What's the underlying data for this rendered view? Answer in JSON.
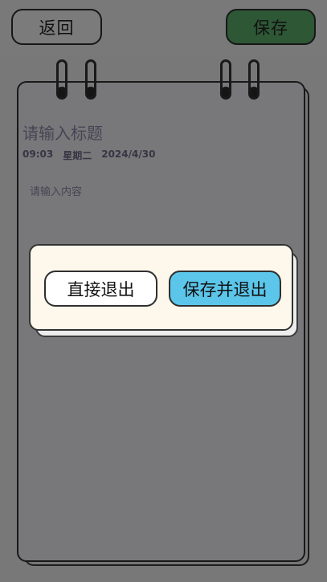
{
  "header": {
    "back_label": "返回",
    "save_label": "保存"
  },
  "note": {
    "title_placeholder": "请输入标题",
    "time": "09:03",
    "weekday": "星期二",
    "date": "2024/4/30",
    "content_placeholder": "请输入内容"
  },
  "dialog": {
    "exit_label": "直接退出",
    "save_exit_label": "保存并退出"
  },
  "colors": {
    "save_button": "#5cae6d",
    "save_exit_button": "#5bc6ea",
    "dialog_bg": "#fdf8eb"
  }
}
